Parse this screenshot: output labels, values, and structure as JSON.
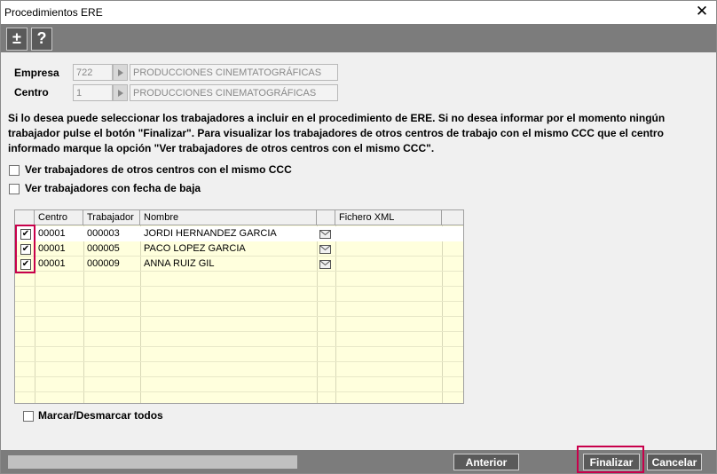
{
  "window": {
    "title": "Procedimientos ERE",
    "close_glyph": "✕"
  },
  "toolbar": {
    "plus_minus_label": "±",
    "help_label": "?"
  },
  "form": {
    "empresa": {
      "label": "Empresa",
      "code": "722",
      "name": "PRODUCCIONES CINEMTATOGRÁFICAS"
    },
    "centro": {
      "label": "Centro",
      "code": "1",
      "name": "PRODUCCIONES CINEMATOGRÁFICAS"
    }
  },
  "info_text": "Si lo desea puede seleccionar los trabajadores a incluir en el procedimiento de ERE. Si no desea informar por el momento ningún trabajador pulse el botón \"Finalizar\". Para visualizar los trabajadores de otros centros de trabajo con el mismo CCC que el centro informado marque la opción \"Ver trabajadores de otros centros con el mismo CCC\".",
  "options": {
    "otros_centros": {
      "label": "Ver trabajadores de otros centros con el mismo CCC",
      "checked": false
    },
    "fecha_baja": {
      "label": "Ver trabajadores con fecha de baja",
      "checked": false
    }
  },
  "table": {
    "columns": [
      "Centro",
      "Trabajador",
      "Nombre",
      "",
      "Fichero XML"
    ],
    "rows": [
      {
        "checked": true,
        "centro": "00001",
        "trabajador": "000003",
        "nombre": "JORDI HERNANDEZ GARCIA",
        "icon": "envelope-icon",
        "fichero": ""
      },
      {
        "checked": true,
        "centro": "00001",
        "trabajador": "000005",
        "nombre": "PACO LOPEZ GARCIA",
        "icon": "envelope-icon",
        "fichero": ""
      },
      {
        "checked": true,
        "centro": "00001",
        "trabajador": "000009",
        "nombre": "ANNA RUIZ GIL",
        "icon": "envelope-icon",
        "fichero": ""
      }
    ]
  },
  "select_all": {
    "label": "Marcar/Desmarcar todos",
    "checked": false
  },
  "buttons": {
    "anterior": "Anterior",
    "finalizar": "Finalizar",
    "cancelar": "Cancelar"
  },
  "colors": {
    "toolbar_bg": "#7c7c7c",
    "grid_bg": "#ffffdd",
    "highlight": "#c8004b",
    "button_bg": "#5a5a5a"
  }
}
